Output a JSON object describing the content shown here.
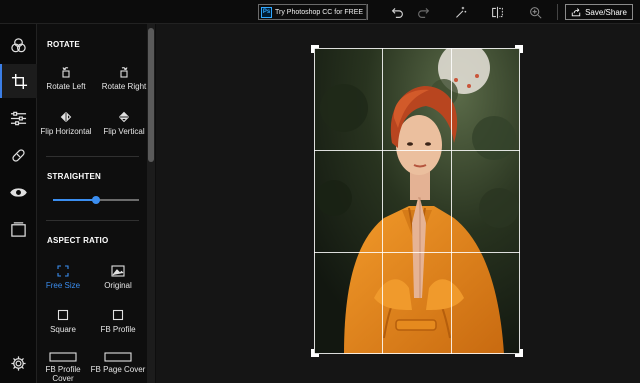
{
  "toolbar": {
    "promo_label": "Try Photoshop CC for FREE",
    "promo_logo": "Ps",
    "save_label": "Save/Share",
    "icons": [
      "undo-icon",
      "redo-icon",
      "auto-fix-icon",
      "compare-icon",
      "zoom-icon",
      "share-icon"
    ]
  },
  "rail": {
    "items": [
      {
        "name": "themes",
        "icon": "circles-icon"
      },
      {
        "name": "crop",
        "icon": "crop-icon",
        "active": true
      },
      {
        "name": "adjustments",
        "icon": "sliders-icon"
      },
      {
        "name": "heal",
        "icon": "bandage-icon"
      },
      {
        "name": "red-eye",
        "icon": "eye-icon"
      },
      {
        "name": "borders",
        "icon": "frame-icon"
      },
      {
        "name": "settings",
        "icon": "gear-icon"
      }
    ]
  },
  "panel": {
    "rotate": {
      "title": "ROTATE",
      "rotate_left": "Rotate Left",
      "rotate_right": "Rotate Right",
      "flip_horizontal": "Flip Horizontal",
      "flip_vertical": "Flip Vertical"
    },
    "straighten": {
      "title": "STRAIGHTEN",
      "value_fraction": 0.5
    },
    "aspect": {
      "title": "ASPECT RATIO",
      "free_size": "Free Size",
      "original": "Original",
      "square": "Square",
      "fb_profile": "FB Profile",
      "fb_profile_cover": "FB Profile Cover",
      "fb_page_cover": "FB Page Cover",
      "selected": "free_size"
    }
  },
  "colors": {
    "accent": "#3b8ef0",
    "background": "#141414",
    "panel": "#0e0e0e"
  }
}
